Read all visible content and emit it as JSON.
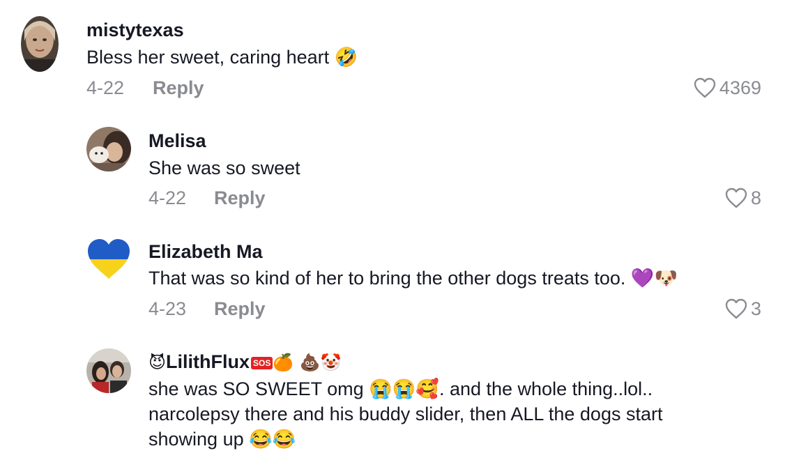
{
  "comments": [
    {
      "username": "mistytexas",
      "text": "Bless her sweet, caring heart 🤣",
      "date": "4-22",
      "reply_label": "Reply",
      "likes": "4369"
    },
    {
      "username": "Melisa",
      "text": "She was so sweet",
      "date": "4-22",
      "reply_label": "Reply",
      "likes": "8"
    },
    {
      "username": "Elizabeth Ma",
      "text": "That was so kind of her to bring the other dogs treats too. 💜🐶",
      "date": "4-23",
      "reply_label": "Reply",
      "likes": "3"
    },
    {
      "username_prefix": "😈",
      "username": "LilithFlux",
      "username_badge": "SOS",
      "username_suffix": "🍊 💩🤡",
      "text_lines": [
        "she was SO SWEET omg 😭😭🥰. and the whole thing..lol..",
        "narcolepsy there and his buddy slider, then ALL the dogs start",
        "showing up 😂😂"
      ]
    }
  ],
  "icons": {
    "like": "heart-outline-icon"
  },
  "colors": {
    "primary_text": "#161823",
    "secondary_text": "#8a8b91"
  }
}
